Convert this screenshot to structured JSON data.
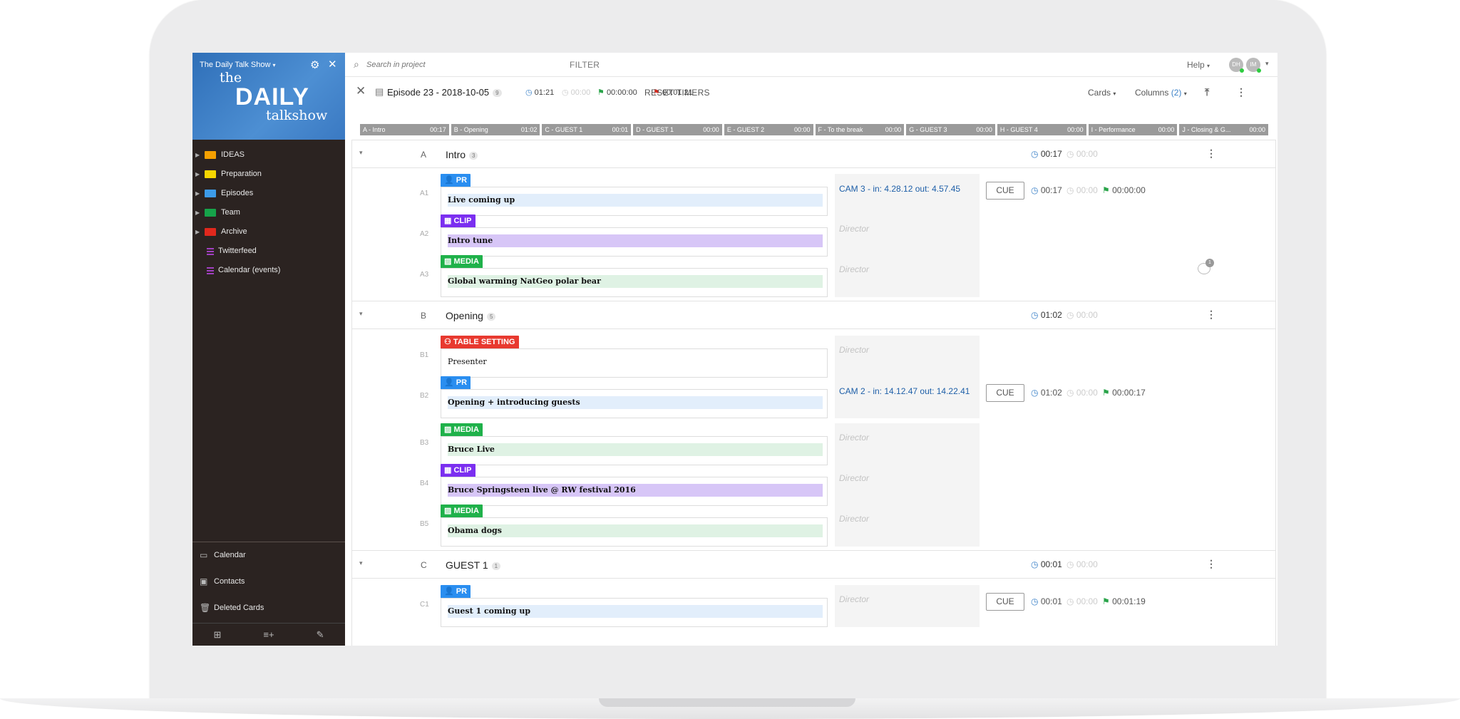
{
  "colors": {
    "pr": "#2a8ef0",
    "clip": "#7b2ff0",
    "media": "#1fb14a",
    "table": "#e8392f",
    "pr_bar": "#e2eefb",
    "clip_bar": "#d7c6f7",
    "media_bar": "#dff2e4"
  },
  "sidebar": {
    "project": "The Daily Talk Show",
    "logo": {
      "the": "the",
      "daily": "DAILY",
      "talkshow": "talkshow"
    },
    "items": [
      {
        "label": "IDEAS",
        "color": "#f5a000",
        "type": "folder"
      },
      {
        "label": "Preparation",
        "color": "#f6d600",
        "type": "folder"
      },
      {
        "label": "Episodes",
        "color": "#3c9be8",
        "type": "folder"
      },
      {
        "label": "Team",
        "color": "#16a34a",
        "type": "folder"
      },
      {
        "label": "Archive",
        "color": "#e0281d",
        "type": "folder"
      },
      {
        "label": "Twitterfeed",
        "color": "#a040c0",
        "type": "list"
      },
      {
        "label": "Calendar (events)",
        "color": "#a040c0",
        "type": "list"
      }
    ],
    "footer": [
      {
        "label": "Calendar",
        "icon": "calendar-icon"
      },
      {
        "label": "Contacts",
        "icon": "contacts-icon"
      },
      {
        "label": "Deleted Cards",
        "icon": "trash-icon"
      }
    ]
  },
  "topbar": {
    "search_placeholder": "Search in project",
    "filter": "FILTER",
    "help": "Help",
    "avatars": [
      "DH",
      "IM"
    ]
  },
  "episode": {
    "title": "Episode 23 - 2018-10-05",
    "count": "9",
    "time1": "01:21",
    "time2": "00:00",
    "time3": "00:00:00",
    "time4": "00:01:21",
    "reset": "RESET TIMERS",
    "cards": "Cards",
    "columns": "Columns",
    "columns_count": "(2)"
  },
  "segments": [
    {
      "label": "A - Intro",
      "time": "00:17"
    },
    {
      "label": "B - Opening",
      "time": "01:02"
    },
    {
      "label": "C - GUEST 1",
      "time": "00:01"
    },
    {
      "label": "D - GUEST 1",
      "time": "00:00"
    },
    {
      "label": "E - GUEST 2",
      "time": "00:00"
    },
    {
      "label": "F - To the break",
      "time": "00:00"
    },
    {
      "label": "G - GUEST 3",
      "time": "00:00"
    },
    {
      "label": "H - GUEST 4",
      "time": "00:00"
    },
    {
      "label": "I - Performance",
      "time": "00:00"
    },
    {
      "label": "J - Closing & G...",
      "time": "00:00"
    }
  ],
  "groups": [
    {
      "letter": "A",
      "name": "Intro",
      "count": "3",
      "t1": "00:17",
      "t2": "00:00"
    },
    {
      "letter": "B",
      "name": "Opening",
      "count": "5",
      "t1": "01:02",
      "t2": "00:00"
    },
    {
      "letter": "C",
      "name": "GUEST 1",
      "count": "1",
      "t1": "00:01",
      "t2": "00:00"
    }
  ],
  "rows": [
    {
      "id": "A1",
      "tag": "PR",
      "tagicon": "person-icon",
      "title": "Live coming up",
      "note": "CAM 3 - in: 4.28.12  out: 4.57.45",
      "cue": "CUE",
      "t1": "00:17",
      "t2": "00:00",
      "t3": "00:00:00"
    },
    {
      "id": "A2",
      "tag": "CLIP",
      "tagicon": "film-icon",
      "title": "Intro tune",
      "note": "Director"
    },
    {
      "id": "A3",
      "tag": "MEDIA",
      "tagicon": "image-icon",
      "title": "Global warming NatGeo polar bear",
      "note": "Director",
      "comments": "1"
    },
    {
      "id": "B1",
      "tag": "TABLE SETTING",
      "tagicon": "table-icon",
      "title": "Presenter",
      "note": "Director"
    },
    {
      "id": "B2",
      "tag": "PR",
      "tagicon": "person-icon",
      "title": "Opening + introducing guests",
      "note": "CAM 2 - in: 14.12.47  out: 14.22.41",
      "cue": "CUE",
      "t1": "01:02",
      "t2": "00:00",
      "t3": "00:00:17"
    },
    {
      "id": "B3",
      "tag": "MEDIA",
      "tagicon": "image-icon",
      "title": "Bruce Live",
      "note": "Director"
    },
    {
      "id": "B4",
      "tag": "CLIP",
      "tagicon": "film-icon",
      "title": "Bruce Springsteen live @ RW festival 2016",
      "note": "Director"
    },
    {
      "id": "B5",
      "tag": "MEDIA",
      "tagicon": "image-icon",
      "title": "Obama dogs",
      "note": "Director"
    },
    {
      "id": "C1",
      "tag": "PR",
      "tagicon": "person-icon",
      "title": "Guest 1 coming up",
      "note": "Director",
      "cue": "CUE",
      "t1": "00:01",
      "t2": "00:00",
      "t3": "00:01:19"
    }
  ]
}
